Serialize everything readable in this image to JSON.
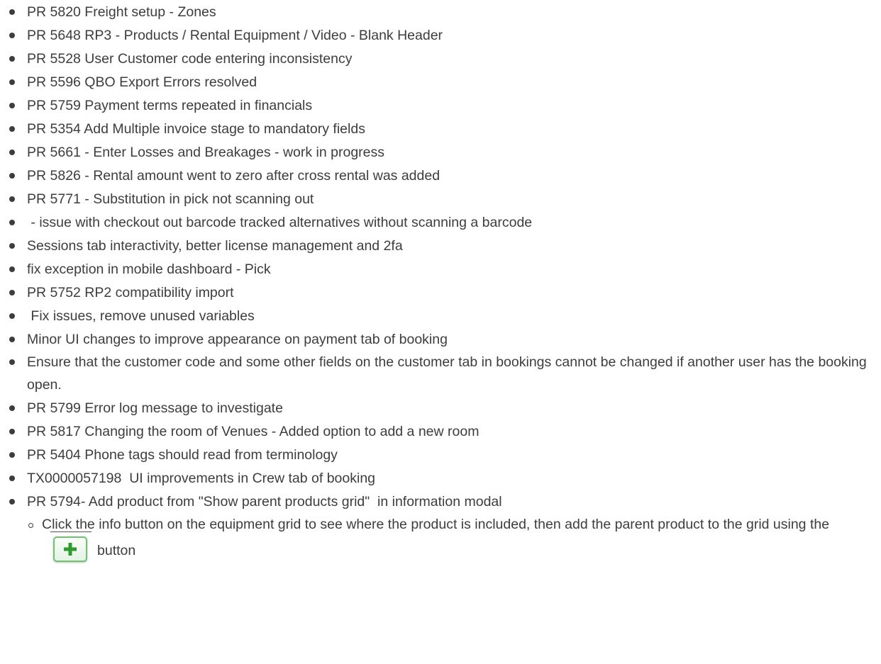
{
  "items": [
    "PR 5820 Freight setup - Zones",
    "PR 5648 RP3 - Products / Rental Equipment / Video - Blank Header",
    "PR 5528 User Customer code entering inconsistency",
    "PR 5596 QBO Export Errors resolved",
    "PR 5759 Payment terms repeated in financials",
    "PR 5354 Add Multiple invoice stage to mandatory fields",
    "PR 5661 - Enter Losses and Breakages - work in progress",
    "PR 5826 - Rental amount went to zero after cross rental was added",
    "PR 5771 - Substitution in pick not scanning out",
    " - issue with checkout out barcode tracked alternatives without scanning a barcode",
    "Sessions tab interactivity, better license management and 2fa",
    "fix exception in mobile dashboard - Pick",
    "PR 5752 RP2 compatibility import",
    " Fix issues, remove unused variables",
    "Minor UI changes to improve appearance on payment tab of booking",
    "Ensure that the customer code and some other fields on the customer tab in bookings cannot be changed if another user has the booking open.",
    "PR 5799 Error log message to investigate",
    "PR 5817 Changing the room of Venues - Added option to add a new room",
    "PR 5404 Phone tags should read from terminology",
    "TX0000057198  UI improvements in Crew tab of booking",
    "PR 5794- Add product from \"Show parent products grid\"  in information modal"
  ],
  "sub_item": {
    "text_before": "Click the info button on the equipment grid to see where the product is included, then add the parent product to the grid using the",
    "text_after": "button",
    "button_icon": "plus-icon",
    "button_color": "#2e9b2e"
  }
}
